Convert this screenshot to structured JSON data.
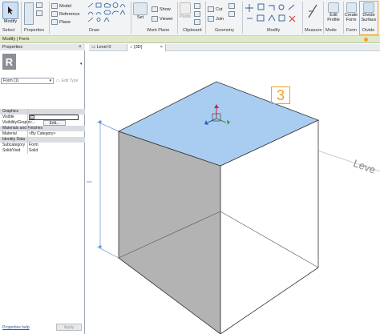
{
  "ribbon": {
    "modify_label": "Modify",
    "select_group": "Select",
    "properties_group": "Properties",
    "draw_group": "Draw",
    "draw_items": [
      "Model",
      "Reference",
      "Plane"
    ],
    "workplane_group": "Work Plane",
    "workplane_items": [
      "Set",
      "Show",
      "Viewer"
    ],
    "clipboard_group": "Clipboard",
    "clipboard_paste": "Paste",
    "geometry_group": "Geometry",
    "geometry_items": [
      "Cut",
      "Join"
    ],
    "modify_group": "Modify",
    "measure_group": "Measure",
    "mode_group": "Mode",
    "mode_item": "Edit Profile",
    "form_group": "Form",
    "form_item": "Create Form",
    "divide_group": "Divide",
    "divide_item": "Divide Surface"
  },
  "context_bar": "Modify | Form",
  "tabs": [
    "Level 0",
    "{3D}"
  ],
  "properties": {
    "title": "Properties",
    "logo": "R",
    "type_selector": "Form (1)",
    "edit_type": "Edit Type",
    "rows": [
      {
        "label": "Graphics",
        "value": "",
        "category": true
      },
      {
        "label": "Visible",
        "value": "",
        "category": false
      },
      {
        "label": "Visibility/Graphic...",
        "value": "Edit...",
        "category": false
      },
      {
        "label": "Materials and Finishes",
        "value": "",
        "category": true
      },
      {
        "label": "Material",
        "value": "<By Category>",
        "category": false
      },
      {
        "label": "Identity Data",
        "value": "",
        "category": true
      },
      {
        "label": "Subcategory",
        "value": "Form",
        "category": false
      },
      {
        "label": "Solid/Void",
        "value": "Solid",
        "category": false
      }
    ],
    "help_link": "Properties help",
    "apply_button": "Apply"
  },
  "view": {
    "callout_number": "3",
    "level_label": "Leve",
    "dimension_text": "I"
  },
  "colors": {
    "selected_face": "#a9cdf0",
    "shaded_face": "#b3b3b3",
    "callout": "#f0a020"
  }
}
